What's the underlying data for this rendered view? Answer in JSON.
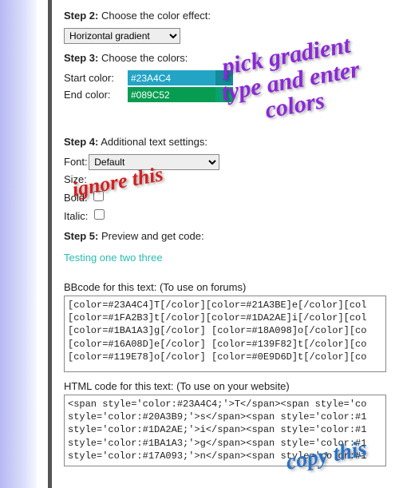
{
  "steps": {
    "s2": {
      "label": "Step 2:",
      "text": "Choose the color effect:"
    },
    "s3": {
      "label": "Step 3:",
      "text": "Choose the colors:"
    },
    "s4": {
      "label": "Step 4:",
      "text": "Additional text settings:"
    },
    "s5": {
      "label": "Step 5:",
      "text": "Preview and get code:"
    }
  },
  "effect": {
    "value": "Horizontal gradient"
  },
  "colors": {
    "start_label": "Start color:",
    "end_label": "End color:",
    "start_hex": "#23A4C4",
    "end_hex": "#089C52"
  },
  "settings": {
    "font_label": "Font:",
    "font_value": "Default",
    "size_label": "Size:",
    "bold_label": "Bold:",
    "italic_label": "Italic:"
  },
  "preview_text": "Testing one two three",
  "bb": {
    "label": "BBcode for this text: (To use on forums)",
    "content": "[color=#23A4C4]T[/color][color=#21A3BE]e[/color][col\n[color=#1FA2B3]t[/color][color=#1DA2AE]i[/color][col\n[color=#1BA1A3]g[/color] [color=#18A098]o[/color][co\n[color=#16A08D]e[/color] [color=#139F82]t[/color][co\n[color=#119E78]o[/color] [color=#0E9D6D]t[/color][co"
  },
  "html": {
    "label": "HTML code for this text: (To use on your website)",
    "content": "<span style='color:#23A4C4;'>T</span><span style='co\nstyle='color:#20A3B9;'>s</span><span style='color:#1\nstyle='color:#1DA2AE;'>i</span><span style='color:#1\nstyle='color:#1BA1A3;'>g</span><span style='color:#1\nstyle='color:#17A093;'>n</span><span style='color:#1"
  },
  "annotations": {
    "purple": "pick gradient\ntype and enter\ncolors",
    "red": "ignore this",
    "blue": "copy this"
  }
}
